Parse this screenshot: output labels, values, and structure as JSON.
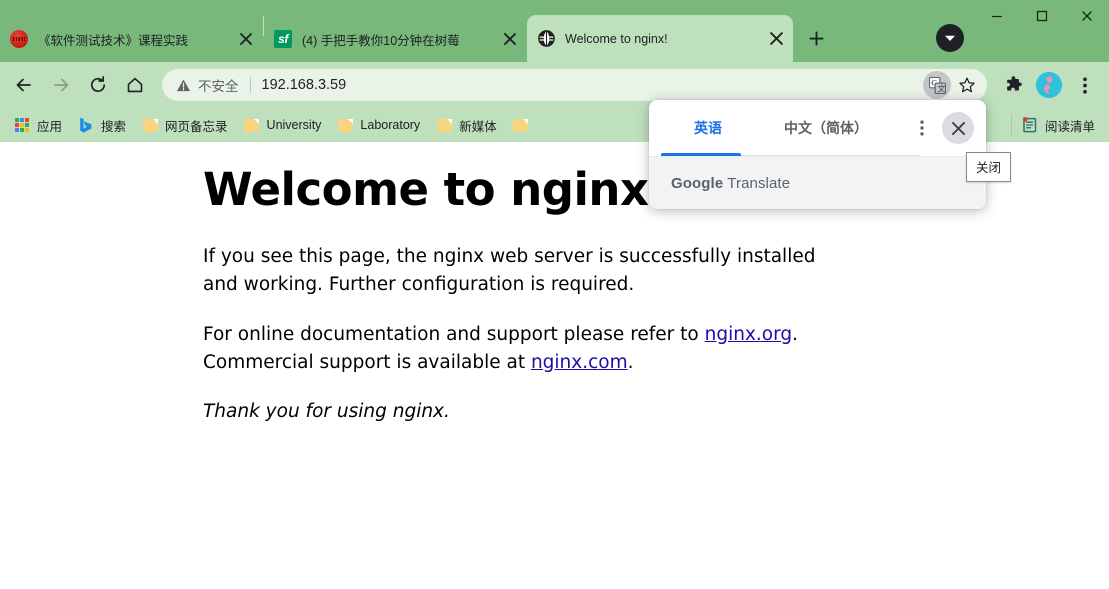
{
  "window": {
    "controls": [
      {
        "name": "minimize",
        "glyph": "minimize-icon"
      },
      {
        "name": "maximize",
        "glyph": "maximize-icon"
      },
      {
        "name": "close",
        "glyph": "close-icon"
      }
    ],
    "chrome_color": "#78b87a",
    "toolbar_color": "#bfe0bd"
  },
  "tabstrip": {
    "tabs": [
      {
        "title": "《软件测试技术》课程实践",
        "favicon": "red-circle-icon",
        "active": false,
        "close_label": "close-tab-icon"
      },
      {
        "title": "(4) 手把手教你10分钟在树莓",
        "favicon": "segmentfault-sf-icon",
        "active": false,
        "close_label": "close-tab-icon"
      },
      {
        "title": "Welcome to nginx!",
        "favicon": "globe-icon",
        "active": true,
        "close_label": "close-tab-icon"
      }
    ],
    "new_tab_label": "new-tab-icon",
    "tab_search_label": "tab-search-icon"
  },
  "toolbar": {
    "back_label": "back-arrow-icon",
    "forward_label": "forward-arrow-icon",
    "reload_label": "reload-icon",
    "home_label": "home-icon",
    "omnibox": {
      "security_icon": "warning-triangle-icon",
      "security_label": "不安全",
      "url": "192.168.3.59"
    },
    "translate_icon_label": "translate-icon",
    "bookmark_icon_label": "star-icon",
    "extensions_label": "puzzle-icon",
    "profile_label": "avatar",
    "menu_label": "three-dot-menu-icon"
  },
  "bookmarks": {
    "items": [
      {
        "label": "应用",
        "icon": "apps-grid-icon"
      },
      {
        "label": "搜索",
        "icon": "bing-search-icon"
      },
      {
        "label": "网页备忘录",
        "icon": "folder-icon"
      },
      {
        "label": "University",
        "icon": "folder-icon"
      },
      {
        "label": "Laboratory",
        "icon": "folder-icon"
      },
      {
        "label": "新媒体",
        "icon": "folder-icon"
      },
      {
        "label": "",
        "icon": "folder-icon"
      }
    ],
    "reading_list": {
      "label": "阅读清单",
      "icon": "reading-list-icon",
      "has_badge": true
    }
  },
  "translate_bubble": {
    "tabs": [
      {
        "label": "英语",
        "selected": true
      },
      {
        "label": "中文（简体）",
        "selected": false
      }
    ],
    "more_label": "three-dot-menu-icon",
    "close_label": "close-icon",
    "footer_brand_bold": "Google",
    "footer_brand_rest": " Translate",
    "accent_color": "#1a73e8"
  },
  "tooltip": {
    "text": "关闭"
  },
  "page": {
    "heading": "Welcome to nginx!",
    "paragraph1": "If you see this page, the nginx web server is successfully installed and working. Further configuration is required.",
    "paragraph2_pre": "For online documentation and support please refer to ",
    "link1": "nginx.org",
    "paragraph2_mid": ".",
    "paragraph2_line2_pre": "Commercial support is available at ",
    "link2": "nginx.com",
    "paragraph2_post": ".",
    "thanks": "Thank you for using nginx.",
    "link_color": "#1a0dab"
  }
}
